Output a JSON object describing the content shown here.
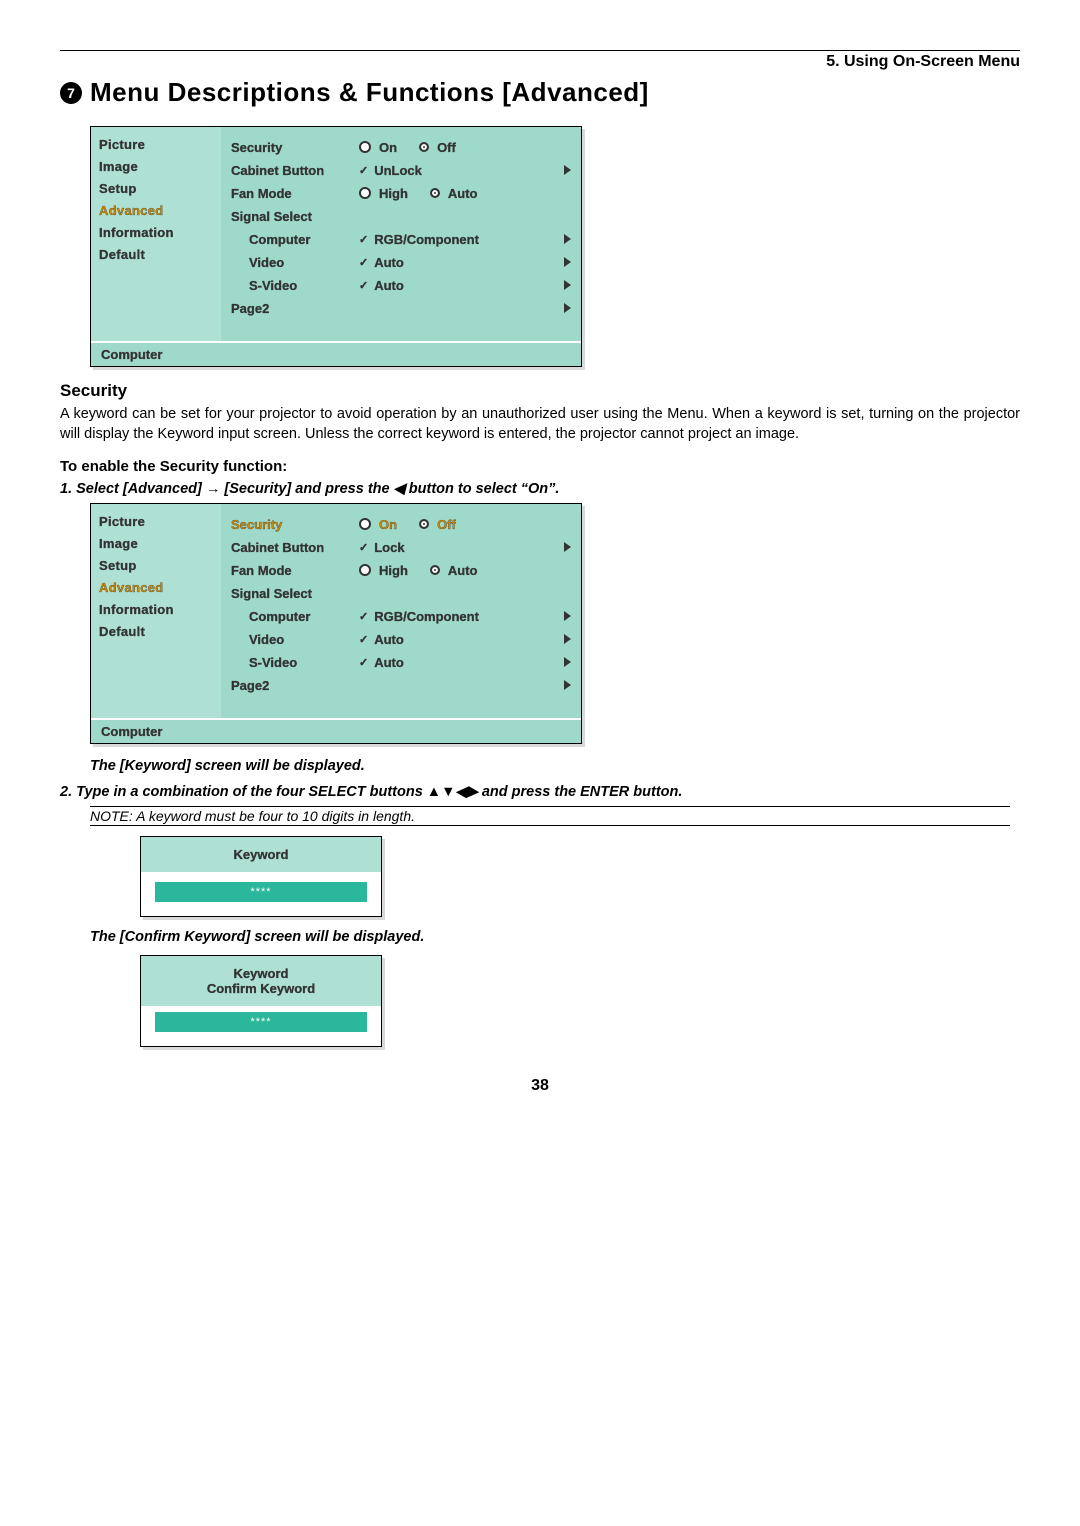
{
  "breadcrumb": "5. Using On-Screen Menu",
  "heading_number": "7",
  "heading": "Menu Descriptions & Functions [Advanced]",
  "sidebar_items": [
    "Picture",
    "Image",
    "Setup",
    "Advanced",
    "Information",
    "Default"
  ],
  "sidebar_selected": "Advanced",
  "menu1": {
    "security": {
      "label": "Security",
      "opt_on": "On",
      "opt_off": "Off",
      "selected": "Off"
    },
    "cabinet": {
      "label": "Cabinet Button",
      "value": "UnLock"
    },
    "fan": {
      "label": "Fan Mode",
      "opt_high": "High",
      "opt_auto": "Auto",
      "selected": "Auto"
    },
    "signal_select": {
      "label": "Signal Select"
    },
    "computer": {
      "label": "Computer",
      "value": "RGB/Component"
    },
    "video": {
      "label": "Video",
      "value": "Auto"
    },
    "svideo": {
      "label": "S-Video",
      "value": "Auto"
    },
    "page2": {
      "label": "Page2"
    },
    "status": "Computer"
  },
  "security_heading": "Security",
  "security_body": "A keyword can be set for your projector to avoid operation by an unauthorized user using the Menu. When a keyword is set, turning on the projector will display the Keyword input screen. Unless the correct keyword is entered, the projector cannot project an image.",
  "enable_heading": "To enable the Security function:",
  "step1": "1. Select [Advanced] → [Security] and press the ◀ button to select “On”.",
  "menu2": {
    "security": {
      "label": "Security",
      "opt_on": "On",
      "opt_off": "Off",
      "selected": "Off"
    },
    "cabinet": {
      "label": "Cabinet Button",
      "value": "Lock"
    },
    "fan": {
      "label": "Fan Mode",
      "opt_high": "High",
      "opt_auto": "Auto",
      "selected": "Auto"
    },
    "signal_select": {
      "label": "Signal Select"
    },
    "computer": {
      "label": "Computer",
      "value": "RGB/Component"
    },
    "video": {
      "label": "Video",
      "value": "Auto"
    },
    "svideo": {
      "label": "S-Video",
      "value": "Auto"
    },
    "page2": {
      "label": "Page2"
    },
    "status": "Computer",
    "highlighted": "Security"
  },
  "result1": "The [Keyword] screen will be displayed.",
  "step2": "2. Type in a combination of the four SELECT buttons ▲▼◀▶ and press the ENTER button.",
  "note": "NOTE: A keyword must be four to 10 digits in length.",
  "keyword_dialog": {
    "title": "Keyword",
    "value": "****"
  },
  "result2": "The [Confirm Keyword] screen will be displayed.",
  "confirm_dialog": {
    "title1": "Keyword",
    "title2": "Confirm Keyword",
    "value": "****"
  },
  "page_number": "38"
}
